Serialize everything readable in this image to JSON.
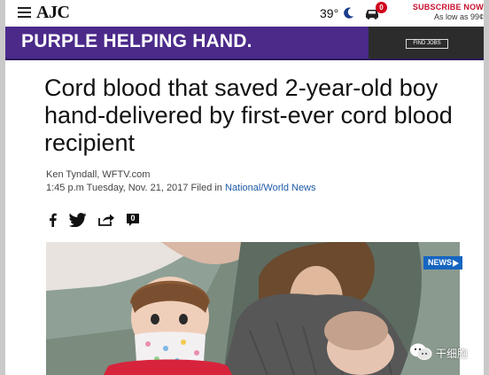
{
  "header": {
    "logo": "AJC",
    "temperature": "39°",
    "weather_icon": "moon-icon",
    "notification_count": "0",
    "subscribe_label": "SUBSCRIBE NOW",
    "subscribe_price": "As low as 99¢"
  },
  "banner": {
    "text": "PURPLE HELPING HAND.",
    "button_label": "FIND JOBS",
    "color": "#4b2a8a"
  },
  "article": {
    "headline": "Cord blood that saved 2-year-old boy hand-delivered by first-ever cord blood recipient",
    "author": "Ken Tyndall, WFTV.com",
    "dateline": "1:45 p.m Tuesday, Nov. 21, 2017 Filed in ",
    "section_link": "National/World News",
    "comment_count": "0"
  },
  "photo": {
    "tag_label": "NEWS"
  },
  "watermark": {
    "text": "干细胞"
  },
  "colors": {
    "accent_red": "#c8102e",
    "link_blue": "#1f5aa6",
    "news_blue": "#1665c1"
  }
}
